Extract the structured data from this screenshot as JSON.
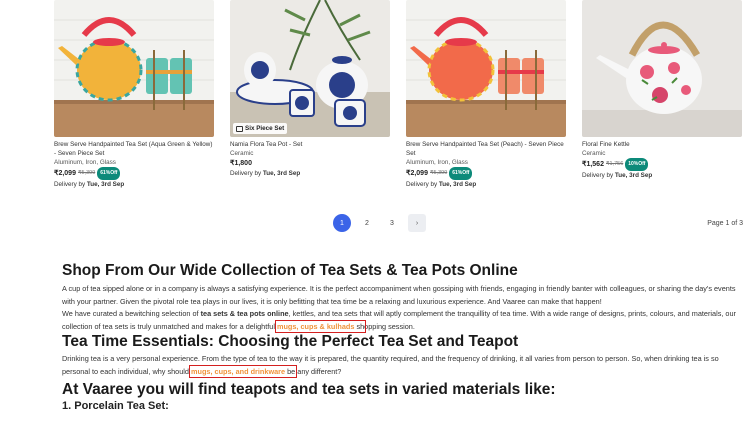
{
  "products": [
    {
      "name": "Brew Serve Handpainted Tea Set (Aqua Green & Yellow) - Seven Piece Set",
      "material": "Aluminum, Iron, Glass",
      "price": "₹2,099",
      "old_price": "₹5,399",
      "discount": "61%Off",
      "delivery_prefix": "Delivery by",
      "delivery_date": "Tue, 3rd Sep",
      "badge": ""
    },
    {
      "name": "Namia Flora Tea Pot - Set",
      "material": "Ceramic",
      "price": "₹1,800",
      "old_price": "",
      "discount": "",
      "delivery_prefix": "Delivery by",
      "delivery_date": "Tue, 3rd Sep",
      "badge": "Six Piece Set"
    },
    {
      "name": "Brew Serve Handpainted Tea Set (Peach) - Seven Piece Set",
      "material": "Aluminum, Iron, Glass",
      "price": "₹2,099",
      "old_price": "₹5,399",
      "discount": "61%Off",
      "delivery_prefix": "Delivery by",
      "delivery_date": "Tue, 3rd Sep",
      "badge": ""
    },
    {
      "name": "Floral Fine Kettle",
      "material": "Ceramic",
      "price": "₹1,562",
      "old_price": "₹1,756",
      "discount": "10%Off",
      "delivery_prefix": "Delivery by",
      "delivery_date": "Tue, 3rd Sep",
      "badge": ""
    }
  ],
  "pagination": {
    "pages": [
      "1",
      "2",
      "3"
    ],
    "active": "1",
    "next_label": "›",
    "page_info": "Page 1 of 3"
  },
  "article": {
    "heading1": "Shop From Our Wide Collection of Tea Sets & Tea Pots Online",
    "para1": "A cup of tea sipped alone or in a company is always a satisfying experience. It is the perfect accompaniment when gossiping with friends, engaging in friendly banter with colleagues, or sharing the day's events with your partner. Given the pivotal role tea plays in our lives, it is only befitting that tea time be a relaxing and luxurious experience. And Vaaree can make that happen!",
    "para2_a": "We have curated a bewitching selection of ",
    "para2_bold": "tea sets & tea pots online",
    "para2_b": ", kettles, and tea sets that will aptly complement the tranquillity of tea time. With a wide range of designs, prints, colours, and materials, our collection of tea sets is truly unmatched and makes for a delightful ",
    "para2_link": "mugs, cups & kulhads",
    "para2_link_tail": " sh",
    "para2_c": "opping session.",
    "heading2": "Tea Time Essentials: Choosing the Perfect Tea Set and Teapot",
    "para3_a": "Drinking tea is a very personal experience. From the type of tea to the way it is prepared, the quantity required, and the frequency of drinking, it all varies from person to person. So, when drinking tea is so personal to each individual, why should ",
    "para3_link": "mugs, cups, and drinkware",
    "para3_link_tail": " be",
    "para3_c": " any different?",
    "heading3": "At Vaaree you will find teapots and tea sets in varied materials like:",
    "list_item1": "1. Porcelain Tea Set:"
  },
  "colors": {
    "accent_blue": "#3b64e8",
    "link_orange": "#f0933a",
    "highlight_box": "#d41f1f",
    "discount_green": "#0d8a7a"
  }
}
